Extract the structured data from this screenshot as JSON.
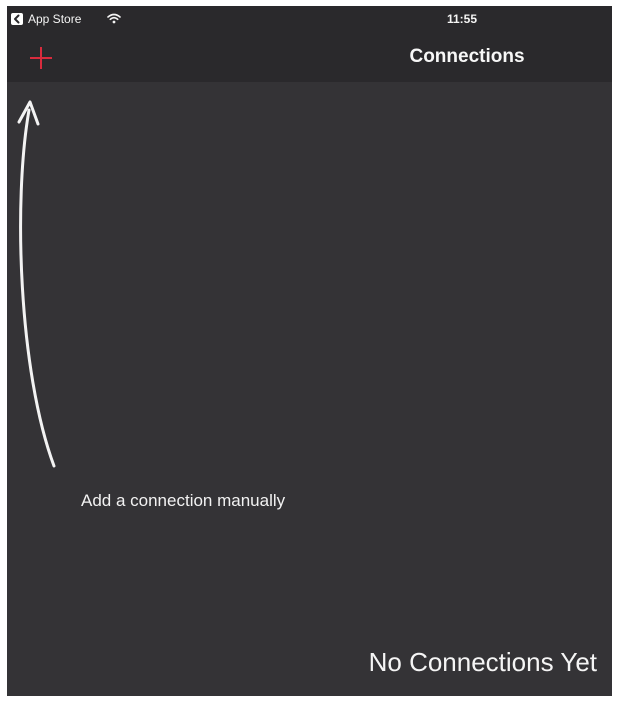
{
  "status_bar": {
    "back_app_label": "App Store",
    "time": "11:55",
    "back_icon": "chevron-left-icon",
    "wifi_icon": "wifi-icon"
  },
  "nav": {
    "title": "Connections",
    "add_icon": "plus-icon"
  },
  "content": {
    "hint": "Add a connection manually",
    "empty_state": "No Connections Yet"
  },
  "colors": {
    "background": "#343336",
    "bar": "#2a292c",
    "accent": "#d92b3d",
    "text": "#f5f5f5"
  }
}
